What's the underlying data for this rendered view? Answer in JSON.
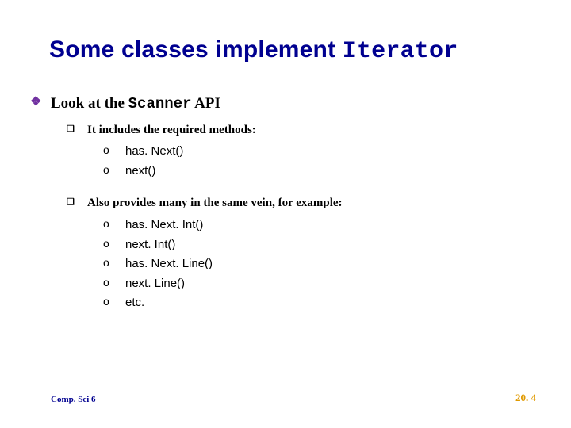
{
  "title": {
    "prefix": "Some classes implement ",
    "code": "Iterator"
  },
  "lvl1": {
    "prefix": "Look at the ",
    "code": "Scanner",
    "suffix": " API"
  },
  "group1": {
    "heading": "It includes the required methods:",
    "items": [
      "has. Next()",
      "next()"
    ]
  },
  "group2": {
    "heading": "Also provides many in the same vein, for example:",
    "items": [
      "has. Next. Int()",
      "next. Int()",
      "has. Next. Line()",
      "next. Line()",
      "etc."
    ]
  },
  "bullets": {
    "diamond": "❖",
    "square": "❑",
    "circle": "o"
  },
  "footer": {
    "left": "Comp. Sci 6",
    "right": "20. 4"
  }
}
